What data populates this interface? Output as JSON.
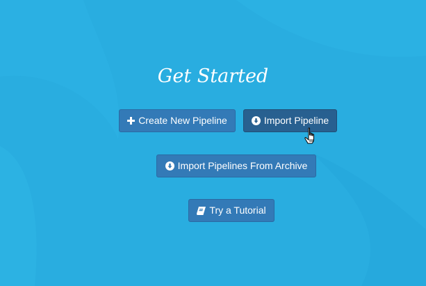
{
  "page": {
    "title": "Get Started"
  },
  "buttons": {
    "create": {
      "label": "Create New Pipeline",
      "icon": "plus-icon"
    },
    "import": {
      "label": "Import Pipeline",
      "icon": "download-circle-icon"
    },
    "archive": {
      "label": "Import Pipelines From Archive",
      "icon": "download-circle-icon"
    },
    "tutorial": {
      "label": "Try a Tutorial",
      "icon": "book-icon"
    }
  },
  "colors": {
    "background": "#29ade0",
    "button": "#337ab7",
    "button_active": "#286090",
    "text": "#ffffff"
  }
}
